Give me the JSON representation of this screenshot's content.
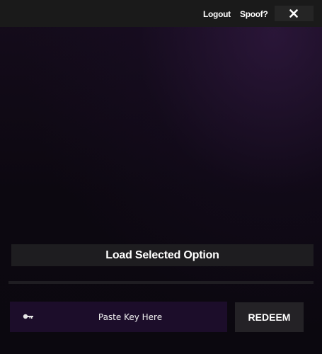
{
  "topbar": {
    "logout_label": "Logout",
    "spoof_label": "Spoof?",
    "close_icon": "close-icon"
  },
  "main": {
    "load_button_label": "Load Selected Option",
    "progress": 0
  },
  "key": {
    "icon": "key-icon",
    "placeholder": "Paste Key Here",
    "value": "",
    "redeem_label": "REDEEM"
  },
  "colors": {
    "topbar_bg": "#1a1a1a",
    "key_field_bg": "#1c0d2a",
    "button_bg": "#1e1d20"
  }
}
